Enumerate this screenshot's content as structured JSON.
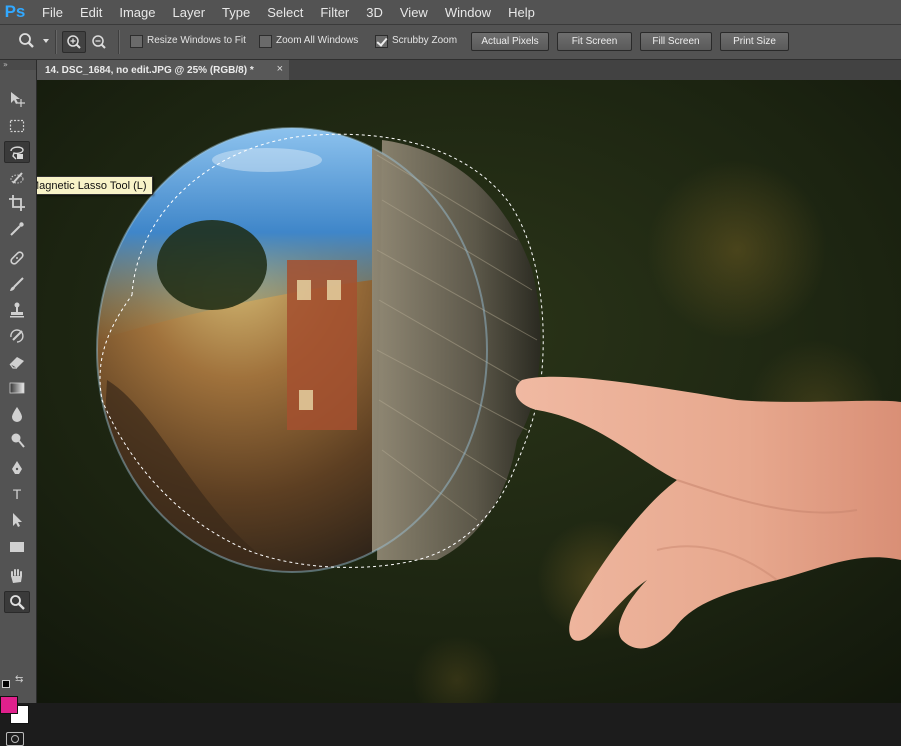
{
  "app": {
    "logo": "Ps"
  },
  "menu": [
    "File",
    "Edit",
    "Image",
    "Layer",
    "Type",
    "Select",
    "Filter",
    "3D",
    "View",
    "Window",
    "Help"
  ],
  "options": {
    "resize_windows": {
      "label": "Resize Windows to Fit",
      "checked": false
    },
    "zoom_all": {
      "label": "Zoom All Windows",
      "checked": false
    },
    "scrubby_zoom": {
      "label": "Scrubby Zoom",
      "checked": true
    },
    "buttons": [
      "Actual Pixels",
      "Fit Screen",
      "Fill Screen",
      "Print Size"
    ]
  },
  "document_tab": {
    "title": "14. DSC_1684, no edit.JPG @ 25% (RGB/8) *",
    "close": "×"
  },
  "toolbar": {
    "grip": "»",
    "tools": [
      {
        "name": "move-tool",
        "icon": "move-icon"
      },
      {
        "name": "marquee-tool",
        "icon": "rect-marquee-icon"
      },
      {
        "name": "magnetic-lasso-tool",
        "icon": "magnetic-lasso-icon",
        "active": true
      },
      {
        "name": "quick-selection-tool",
        "icon": "quick-selection-icon"
      },
      {
        "name": "crop-tool",
        "icon": "crop-icon"
      },
      {
        "name": "eyedropper-tool",
        "icon": "eyedropper-icon"
      },
      {
        "name": "healing-brush-tool",
        "icon": "bandage-icon"
      },
      {
        "name": "brush-tool",
        "icon": "brush-icon"
      },
      {
        "name": "clone-stamp-tool",
        "icon": "stamp-icon"
      },
      {
        "name": "history-brush-tool",
        "icon": "history-brush-icon"
      },
      {
        "name": "eraser-tool",
        "icon": "eraser-icon"
      },
      {
        "name": "gradient-tool",
        "icon": "gradient-icon"
      },
      {
        "name": "blur-tool",
        "icon": "drop-icon"
      },
      {
        "name": "dodge-tool",
        "icon": "dodge-icon"
      },
      {
        "name": "pen-tool",
        "icon": "pen-icon"
      },
      {
        "name": "type-tool",
        "icon": "type-icon",
        "char": "T"
      },
      {
        "name": "path-selection-tool",
        "icon": "arrow-icon"
      },
      {
        "name": "rectangle-tool",
        "icon": "rectangle-icon"
      },
      {
        "name": "hand-tool",
        "icon": "hand-icon"
      },
      {
        "name": "zoom-tool",
        "icon": "magnifier-icon",
        "active": true
      }
    ],
    "foreground_color": "#e0208c",
    "background_color": "#ffffff"
  },
  "tooltip": "Magnetic Lasso Tool (L)"
}
